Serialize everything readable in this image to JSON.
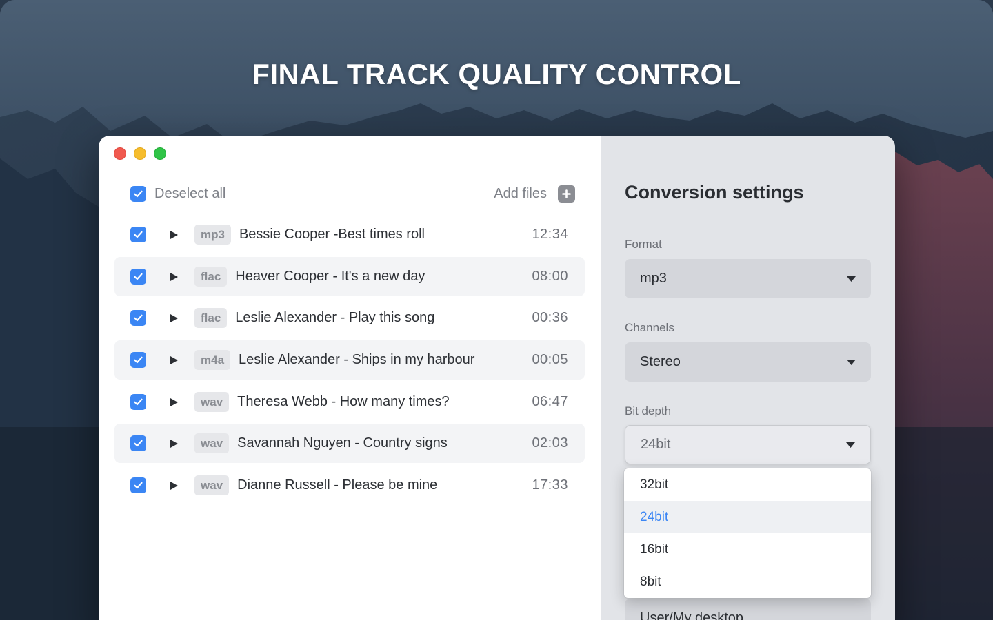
{
  "hero": {
    "title": "FINAL TRACK QUALITY CONTROL"
  },
  "window": {
    "controls": [
      "close",
      "minimize",
      "zoom"
    ]
  },
  "list": {
    "deselect_all_label": "Deselect all",
    "add_files_label": "Add files",
    "tracks": [
      {
        "format": "mp3",
        "title": "Bessie Cooper -Best times roll",
        "duration": "12:34",
        "checked": true
      },
      {
        "format": "flac",
        "title": "Heaver Cooper - It's a new day",
        "duration": "08:00",
        "checked": true
      },
      {
        "format": "flac",
        "title": "Leslie Alexander - Play this song",
        "duration": "00:36",
        "checked": true
      },
      {
        "format": "m4a",
        "title": "Leslie Alexander  - Ships in my harbour",
        "duration": "00:05",
        "checked": true
      },
      {
        "format": "wav",
        "title": "Theresa Webb - How many times?",
        "duration": "06:47",
        "checked": true
      },
      {
        "format": "wav",
        "title": "Savannah Nguyen - Country signs",
        "duration": "02:03",
        "checked": true
      },
      {
        "format": "wav",
        "title": "Dianne Russell - Please be mine",
        "duration": "17:33",
        "checked": true
      }
    ]
  },
  "settings": {
    "title": "Conversion settings",
    "format": {
      "label": "Format",
      "value": "mp3"
    },
    "channels": {
      "label": "Channels",
      "value": "Stereo"
    },
    "bit_depth": {
      "label": "Bit depth",
      "value": "24bit",
      "options": [
        "32bit",
        "24bit",
        "16bit",
        "8bit"
      ],
      "selected": "24bit"
    },
    "destination": {
      "value": "User/My desktop..."
    }
  },
  "colors": {
    "accent": "#3b86f4",
    "checkbox": "#3b86f4",
    "traffic_red": "#f0594f",
    "traffic_yellow": "#f6bd2d",
    "traffic_green": "#30c447"
  },
  "icons": {
    "checkbox": "check-icon",
    "play": "play-icon",
    "add": "plus-icon",
    "caret": "caret-down-icon"
  }
}
